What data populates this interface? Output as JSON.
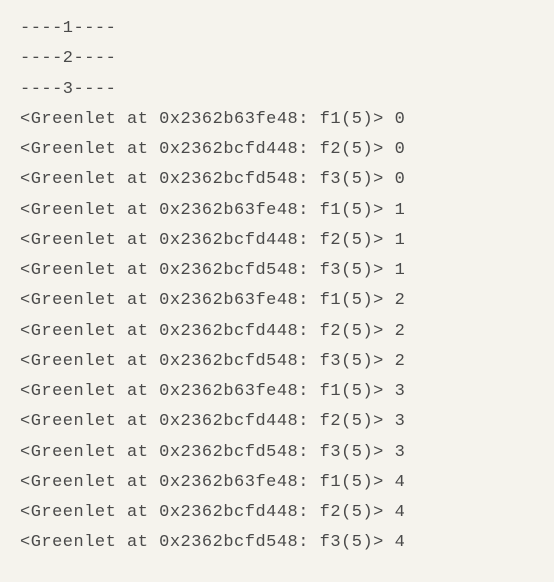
{
  "output": {
    "headers": [
      "----1----",
      "----2----",
      "----3----"
    ],
    "greenlets": [
      {
        "addr": "0x2362b63fe48",
        "fn": "f1",
        "arg": "5",
        "iter": "0"
      },
      {
        "addr": "0x2362bcfd448",
        "fn": "f2",
        "arg": "5",
        "iter": "0"
      },
      {
        "addr": "0x2362bcfd548",
        "fn": "f3",
        "arg": "5",
        "iter": "0"
      },
      {
        "addr": "0x2362b63fe48",
        "fn": "f1",
        "arg": "5",
        "iter": "1"
      },
      {
        "addr": "0x2362bcfd448",
        "fn": "f2",
        "arg": "5",
        "iter": "1"
      },
      {
        "addr": "0x2362bcfd548",
        "fn": "f3",
        "arg": "5",
        "iter": "1"
      },
      {
        "addr": "0x2362b63fe48",
        "fn": "f1",
        "arg": "5",
        "iter": "2"
      },
      {
        "addr": "0x2362bcfd448",
        "fn": "f2",
        "arg": "5",
        "iter": "2"
      },
      {
        "addr": "0x2362bcfd548",
        "fn": "f3",
        "arg": "5",
        "iter": "2"
      },
      {
        "addr": "0x2362b63fe48",
        "fn": "f1",
        "arg": "5",
        "iter": "3"
      },
      {
        "addr": "0x2362bcfd448",
        "fn": "f2",
        "arg": "5",
        "iter": "3"
      },
      {
        "addr": "0x2362bcfd548",
        "fn": "f3",
        "arg": "5",
        "iter": "3"
      },
      {
        "addr": "0x2362b63fe48",
        "fn": "f1",
        "arg": "5",
        "iter": "4"
      },
      {
        "addr": "0x2362bcfd448",
        "fn": "f2",
        "arg": "5",
        "iter": "4"
      },
      {
        "addr": "0x2362bcfd548",
        "fn": "f3",
        "arg": "5",
        "iter": "4"
      }
    ]
  }
}
